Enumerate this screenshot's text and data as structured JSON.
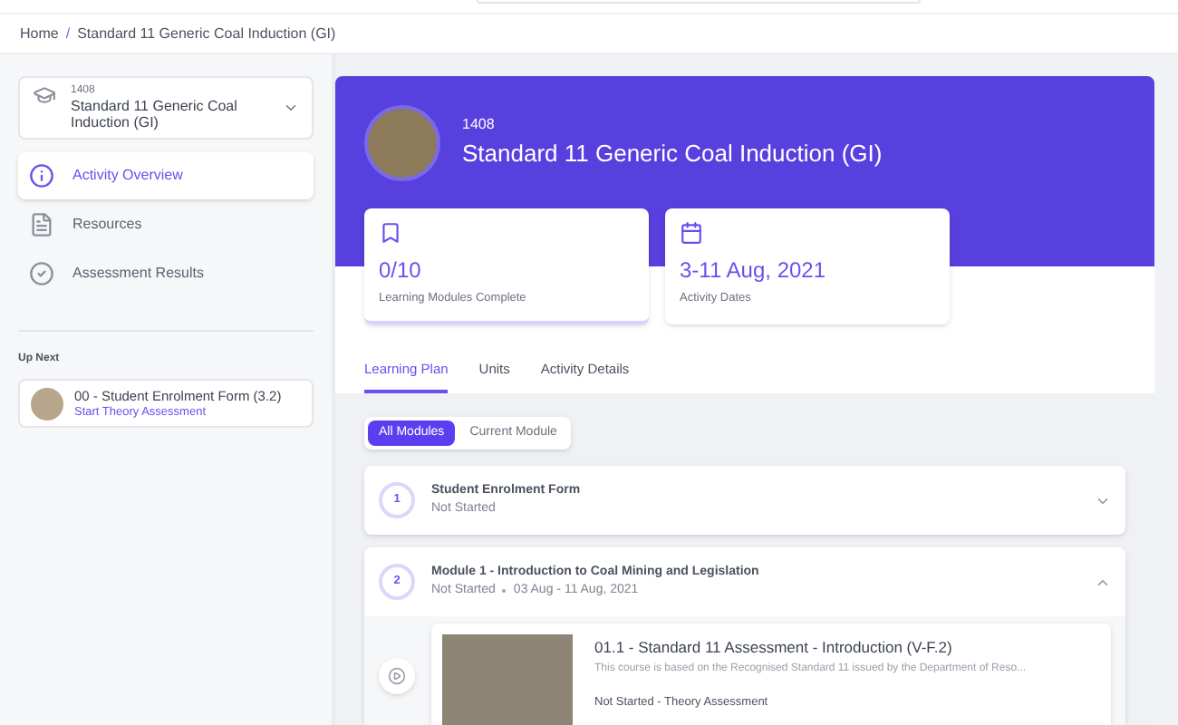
{
  "breadcrumb": [
    {
      "label": "Home"
    },
    {
      "label": "Standard 11 Generic Coal Induction (GI)"
    }
  ],
  "breadcrumb_separator": "/",
  "sidebar": {
    "course": {
      "code": "1408",
      "title": "Standard 11 Generic Coal Induction (GI)"
    },
    "items": [
      {
        "label": "Activity Overview",
        "kind": "info",
        "selected": true
      },
      {
        "label": "Resources",
        "kind": "doc",
        "selected": false
      },
      {
        "label": "Assessment Results",
        "kind": "check",
        "selected": false
      }
    ],
    "up_next": {
      "heading": "Up Next",
      "title": "00 - Student Enrolment Form (3.2)",
      "action": "Start Theory Assessment"
    }
  },
  "header": {
    "code": "1408",
    "title": "Standard 11 Generic Coal Induction (GI)"
  },
  "stats": [
    {
      "kind": "bookmark",
      "value": "0/10",
      "label": "Learning Modules Complete",
      "selected": true
    },
    {
      "kind": "calendar",
      "value": "3-11 Aug, 2021",
      "label": "Activity Dates",
      "selected": false
    }
  ],
  "tabs": [
    {
      "label": "Learning Plan",
      "selected": true
    },
    {
      "label": "Units",
      "selected": false
    },
    {
      "label": "Activity Details",
      "selected": false
    }
  ],
  "filter": [
    {
      "label": "All Modules",
      "selected": true
    },
    {
      "label": "Current Module",
      "selected": false
    }
  ],
  "modules": [
    {
      "number": "1",
      "title": "Student Enrolment Form",
      "status": "Not Started",
      "expanded": false
    },
    {
      "number": "2",
      "title": "Module 1 - Introduction to Coal Mining and Legislation",
      "status": "Not Started",
      "dates": "03 Aug - 11 Aug, 2021",
      "expanded": true,
      "items": [
        {
          "title": "01.1 - Standard 11 Assessment - Introduction (V-F.2)",
          "description": "This course is based on the Recognised Standard 11 issued by the Department of Reso...",
          "status": "Not Started - Theory Assessment"
        }
      ]
    }
  ]
}
